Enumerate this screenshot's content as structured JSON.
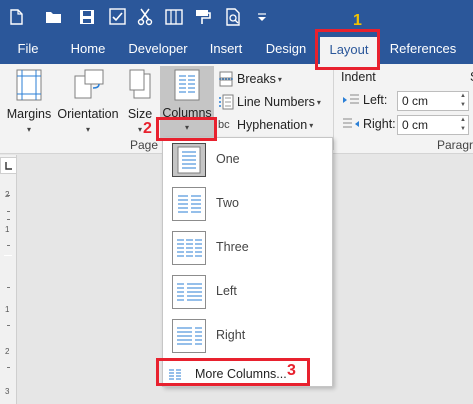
{
  "quick_access": {
    "icons": [
      "new-document-icon",
      "open-folder-icon",
      "save-icon",
      "spelling-check-icon",
      "cut-icon",
      "columns-icon",
      "format-painter-icon",
      "print-preview-icon",
      "customize-dropdown-icon"
    ]
  },
  "tabs": [
    {
      "label": "File"
    },
    {
      "label": "Home"
    },
    {
      "label": "Developer"
    },
    {
      "label": "Insert"
    },
    {
      "label": "Design"
    },
    {
      "label": "Layout",
      "active": true
    },
    {
      "label": "References"
    }
  ],
  "ribbon": {
    "margins": "Margins",
    "orientation": "Orientation",
    "size": "Size",
    "columns": "Columns",
    "breaks": "Breaks",
    "line_numbers": "Line Numbers",
    "hyphenation": "Hyphenation",
    "page_setup_group": "Page S",
    "indent_header": "Indent",
    "indent_left_label": "Left:",
    "indent_left_value": "0 cm",
    "indent_right_label": "Right:",
    "indent_right_value": "0 cm",
    "spacing_partial": "S",
    "paragraph_group": "Paragra",
    "bc_partial": "bc"
  },
  "columns_menu": {
    "items": [
      {
        "label": "One",
        "selected": true
      },
      {
        "label": "Two"
      },
      {
        "label": "Three"
      },
      {
        "label": "Left"
      },
      {
        "label": "Right"
      }
    ],
    "more": "More Columns..."
  },
  "annotations": {
    "step1": "1",
    "step2": "2",
    "step3": "3",
    "color": "#e8212e",
    "step1_color": "#f2c200"
  },
  "ruler": {
    "numbers": [
      "2",
      "1",
      "1",
      "2",
      "3"
    ]
  },
  "colors": {
    "accent": "#2b579a",
    "ribbon": "#f3f3f3"
  }
}
